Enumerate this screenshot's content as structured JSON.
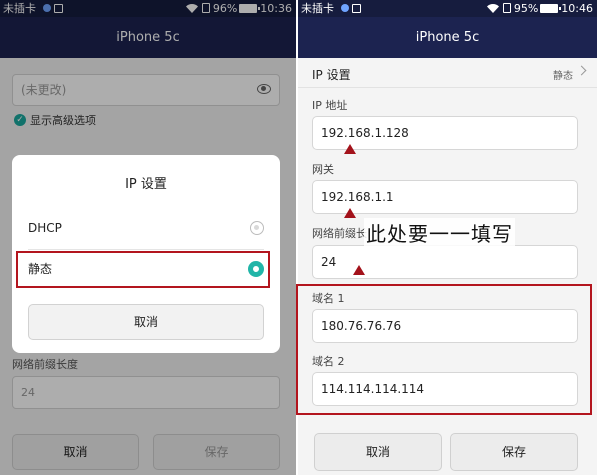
{
  "left": {
    "status": {
      "carrier": "未插卡",
      "battery": "96%",
      "time": "10:36"
    },
    "appbar_title": "iPhone 5c",
    "password_placeholder": "(未更改)",
    "advanced_option": "显示高级选项",
    "bg_prefix_label": "网络前缀长度",
    "bg_prefix_value": "24",
    "bg_cancel": "取消",
    "bg_save": "保存",
    "dialog": {
      "title": "IP 设置",
      "options": [
        {
          "label": "DHCP",
          "selected": false
        },
        {
          "label": "静态",
          "selected": true
        }
      ],
      "cancel": "取消"
    }
  },
  "right": {
    "status": {
      "carrier": "未插卡",
      "battery": "95%",
      "time": "10:46"
    },
    "appbar_title": "iPhone 5c",
    "ip_setting": {
      "label": "IP 设置",
      "value": "静态"
    },
    "fields": [
      {
        "label": "IP 地址",
        "value": "192.168.1.128"
      },
      {
        "label": "网关",
        "value": "192.168.1.1"
      },
      {
        "label": "网络前缀长",
        "value": "24"
      },
      {
        "label": "域名 1",
        "value": "180.76.76.76"
      },
      {
        "label": "域名 2",
        "value": "114.114.114.114"
      }
    ],
    "cancel": "取消",
    "save": "保存"
  },
  "annotation": "此处要一一填写",
  "colors": {
    "appbar": "#1c2350",
    "accent": "#21b5a8",
    "highlight": "#b3151e"
  }
}
